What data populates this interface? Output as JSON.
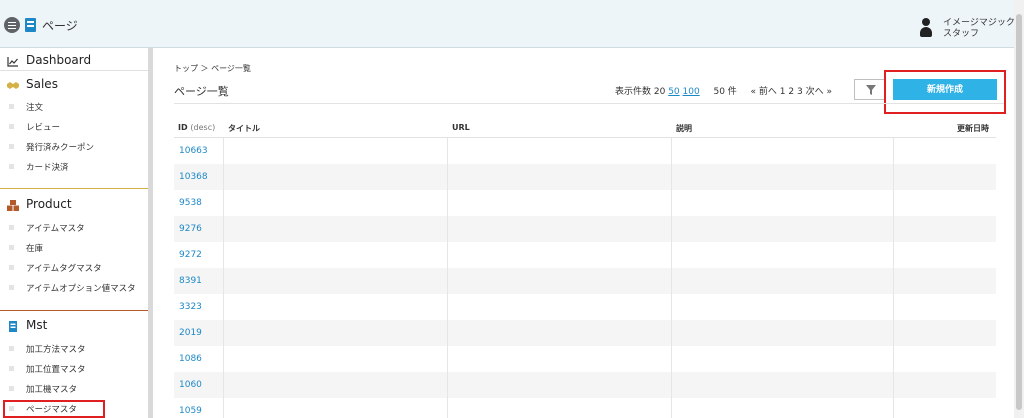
{
  "header": {
    "title": "ページ",
    "user_line1": "イメージマジック",
    "user_line2": "スタッフ"
  },
  "sidebar": {
    "sections": [
      {
        "label": "Dashboard",
        "icon": "chart-line-icon",
        "items": []
      },
      {
        "label": "Sales",
        "icon": "handshake-icon",
        "items": [
          "注文",
          "レビュー",
          "発行済みクーポン",
          "カード決済"
        ]
      },
      {
        "label": "Product",
        "icon": "boxes-icon",
        "items": [
          "アイテムマスタ",
          "在庫",
          "アイテムタグマスタ",
          "アイテムオプション値マスタ"
        ]
      },
      {
        "label": "Mst",
        "icon": "book-icon",
        "items": [
          "加工方法マスタ",
          "加工位置マスタ",
          "加工機マスタ",
          "ページマスタ"
        ]
      }
    ]
  },
  "main": {
    "breadcrumb": "トップ ＞ ページ一覧",
    "heading": "ページ一覧",
    "pager": {
      "count_label": "表示件数 20",
      "option_50": "50",
      "option_100": "100",
      "total": "50 件",
      "prev": "« 前へ",
      "pages": "1 2 3",
      "next": "次へ »"
    },
    "create_button": "新規作成",
    "filter_icon": "filter-icon"
  },
  "table": {
    "columns": {
      "id": "ID",
      "id_sort": "(desc)",
      "title": "タイトル",
      "url": "URL",
      "description": "説明",
      "updated": "更新日時"
    },
    "rows": [
      "10663",
      "10368",
      "9538",
      "9276",
      "9272",
      "8391",
      "3323",
      "2019",
      "1086",
      "1060",
      "1059"
    ]
  },
  "colors": {
    "accent": "#2fb2e6",
    "link": "#1e88c7",
    "highlight": "#e02020"
  }
}
